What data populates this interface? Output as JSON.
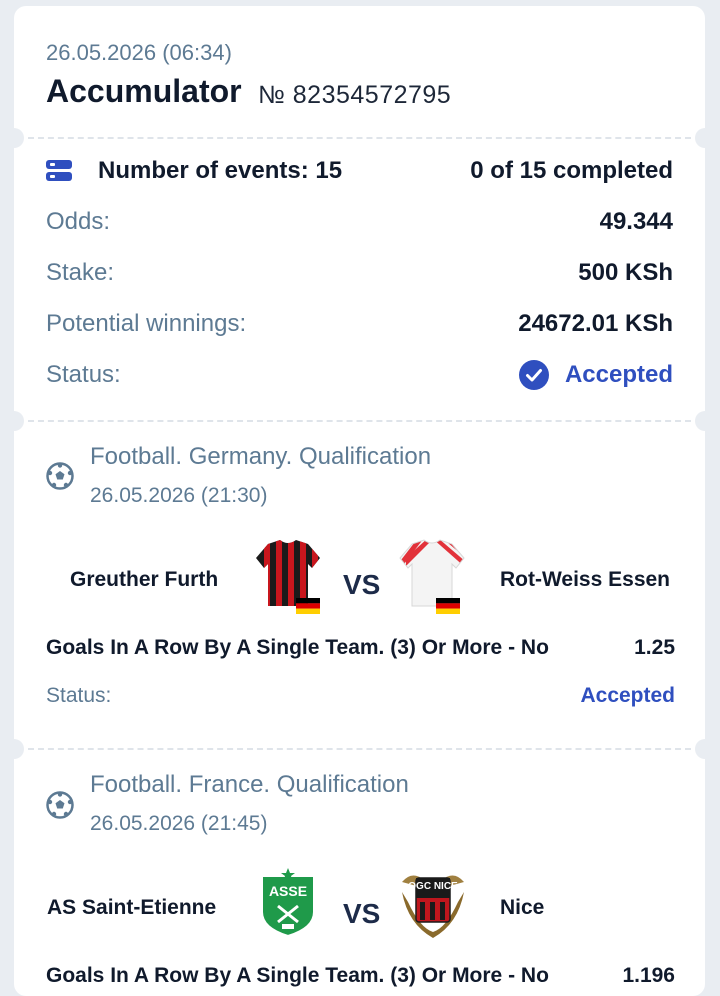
{
  "header": {
    "date": "26.05.2026 (06:34)",
    "title": "Accumulator",
    "number": "№ 82354572795"
  },
  "summary": {
    "events_label": "Number of events: 15",
    "completed": "0 of 15 completed",
    "odds_label": "Odds:",
    "odds_value": "49.344",
    "stake_label": "Stake:",
    "stake_value": "500 KSh",
    "winnings_label": "Potential winnings:",
    "winnings_value": "24672.01 KSh",
    "status_label": "Status:",
    "status_value": "Accepted"
  },
  "events": [
    {
      "league": "Football. Germany. Qualification",
      "date": "26.05.2026 (21:30)",
      "home": "Greuther Furth",
      "away": "Rot-Weiss Essen",
      "vs": "VS",
      "pick": "Goals In A Row By A Single Team. (3) Or More - No",
      "odds": "1.25",
      "status_label": "Status:",
      "status_value": "Accepted",
      "home_colors": [
        "#c8161d",
        "#1a1a1a"
      ],
      "away_colors": [
        "#ffffff",
        "#e2323a"
      ]
    },
    {
      "league": "Football. France. Qualification",
      "date": "26.05.2026 (21:45)",
      "home": "AS Saint-Etienne",
      "away": "Nice",
      "vs": "VS",
      "pick": "Goals In A Row By A Single Team. (3) Or More - No",
      "odds": "1.196",
      "home_logo_text": "ASSE",
      "away_logo_text": "OGC NICE"
    }
  ],
  "colors": {
    "accent": "#2f4fbf",
    "muted": "#5d7a93",
    "text": "#101a2c",
    "background": "#e9edf2"
  }
}
